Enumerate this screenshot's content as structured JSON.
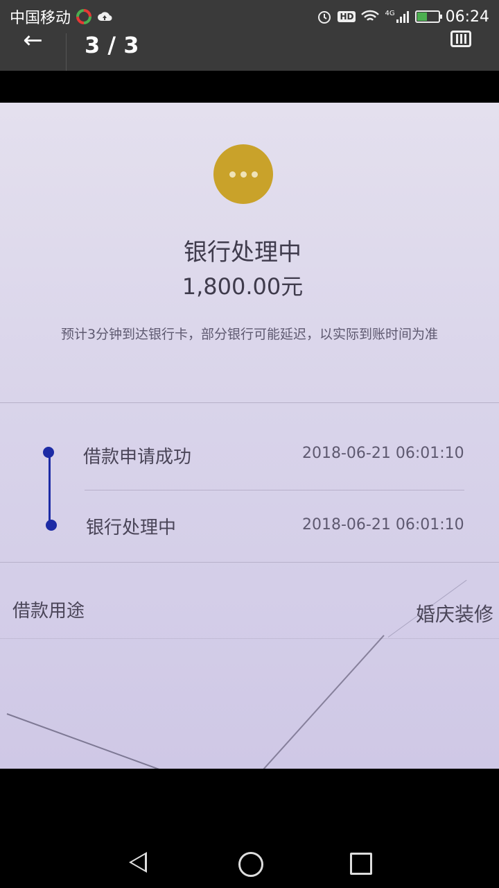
{
  "status_bar": {
    "carrier": "中国移动",
    "network": "4G",
    "hd": "HD",
    "time": "06:24",
    "battery_level": 0.45
  },
  "toolbar": {
    "page_counter": "3 / 3"
  },
  "photo_content": {
    "status_title": "银行处理中",
    "amount": "1,800.00元",
    "note": "预计3分钟到达银行卡，部分银行可能延迟，以实际到账时间为准",
    "timeline": [
      {
        "label": "借款申请成功",
        "time": "2018-06-21 06:01:10"
      },
      {
        "label": "银行处理中",
        "time": "2018-06-21 06:01:10"
      }
    ],
    "purpose_label": "借款用途",
    "purpose_value": "婚庆装修"
  },
  "colors": {
    "status_icon": "#c9a22a",
    "timeline": "#1d2ba5"
  }
}
